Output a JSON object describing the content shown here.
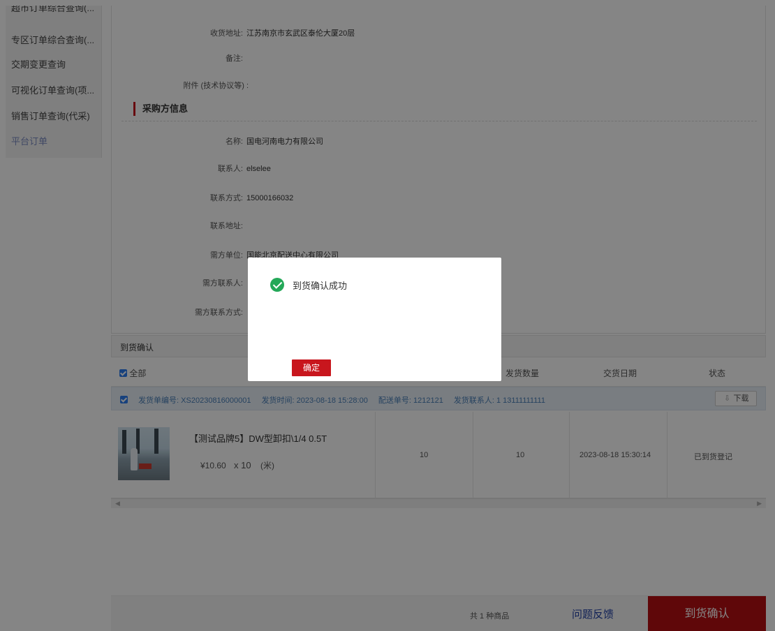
{
  "sidebar": {
    "items": [
      {
        "label": "超市订单综合查询(..."
      },
      {
        "label": "专区订单综合查询(..."
      },
      {
        "label": "交期变更查询"
      },
      {
        "label": "可视化订单查询(项..."
      },
      {
        "label": "销售订单查询(代采)"
      },
      {
        "label": "平台订单"
      }
    ]
  },
  "order_info": {
    "address_label": "收货地址:",
    "address_value": "江苏南京市玄武区泰伦大厦20层",
    "remark_label": "备注:",
    "attachment_label": "附件 (技术协议等) :"
  },
  "buyer": {
    "section_title": "采购方信息",
    "name_label": "名称:",
    "name_value": "国电河南电力有限公司",
    "contact_label": "联系人:",
    "contact_value": "elselee",
    "phone_label": "联系方式:",
    "phone_value": "15000166032",
    "addr_label": "联系地址:",
    "demand_unit_label": "需方单位:",
    "demand_unit_value": "国能北京配送中心有限公司",
    "demand_contact_label": "需方联系人:",
    "demand_phone_label": "需方联系方式:"
  },
  "arrival": {
    "header": "到货确认",
    "columns": {
      "all": "全部",
      "ship_qty": "发货数量",
      "delivery_date": "交货日期",
      "status": "状态"
    },
    "shipment": {
      "order_no": "发货单编号: XS20230816000001",
      "ship_time": "发货时间: 2023-08-18 15:28:00",
      "delivery_no": "配送单号: 1212121",
      "ship_contact": "发货联系人: 1   13111111111",
      "download": "下载"
    },
    "product": {
      "name": "【测试品牌5】DW型卸扣\\1/4 0.5T",
      "price": "¥10.60",
      "qty": "x 10",
      "unit": "(米)",
      "col_qty_a": "10",
      "col_qty_b": "10",
      "date": "2023-08-18 15:30:14",
      "status": "已到货登记"
    }
  },
  "footer": {
    "total": "共 1 种商品",
    "feedback": "问题反馈",
    "confirm": "到货确认"
  },
  "modal": {
    "message": "到货确认成功",
    "ok": "确定"
  },
  "colors": {
    "accent_red": "#b70f12",
    "success_green": "#23a858",
    "link_blue": "#1f3fa5"
  }
}
